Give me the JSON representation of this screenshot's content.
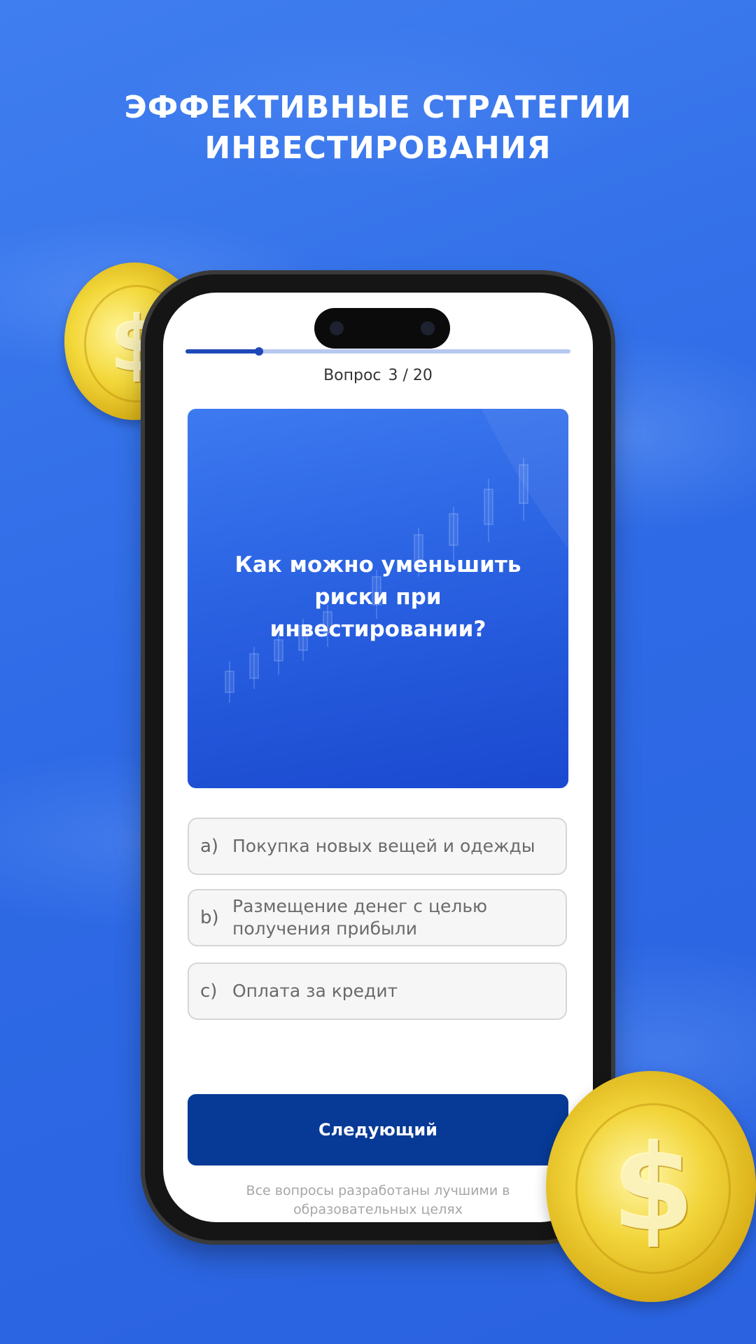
{
  "promo": {
    "headline_line1": "ЭФФЕКТИВНЫЕ СТРАТЕГИИ",
    "headline_line2": "ИНВЕСТИРОВАНИЯ"
  },
  "quiz": {
    "progress_fraction": 0.19,
    "counter_label": "Вопрос",
    "counter_value": "3 / 20",
    "question": "Как можно уменьшить риски при инвестировании?",
    "options": [
      {
        "key": "a)",
        "text": "Покупка новых вещей и одежды"
      },
      {
        "key": "b)",
        "text": "Размещение денег с целью получения прибыли"
      },
      {
        "key": "c)",
        "text": "Оплата за кредит"
      }
    ],
    "next_button": "Следующий",
    "disclaimer": "Все вопросы разработаны лучшими в образовательных целях"
  },
  "colors": {
    "background": "#2f6be6",
    "button": "#063a96",
    "progress_fill": "#1f48b8",
    "progress_track": "#b7c8ee",
    "coin_gold": "#f2d53a"
  },
  "icons": {
    "coin": "dollar-coin-icon"
  }
}
